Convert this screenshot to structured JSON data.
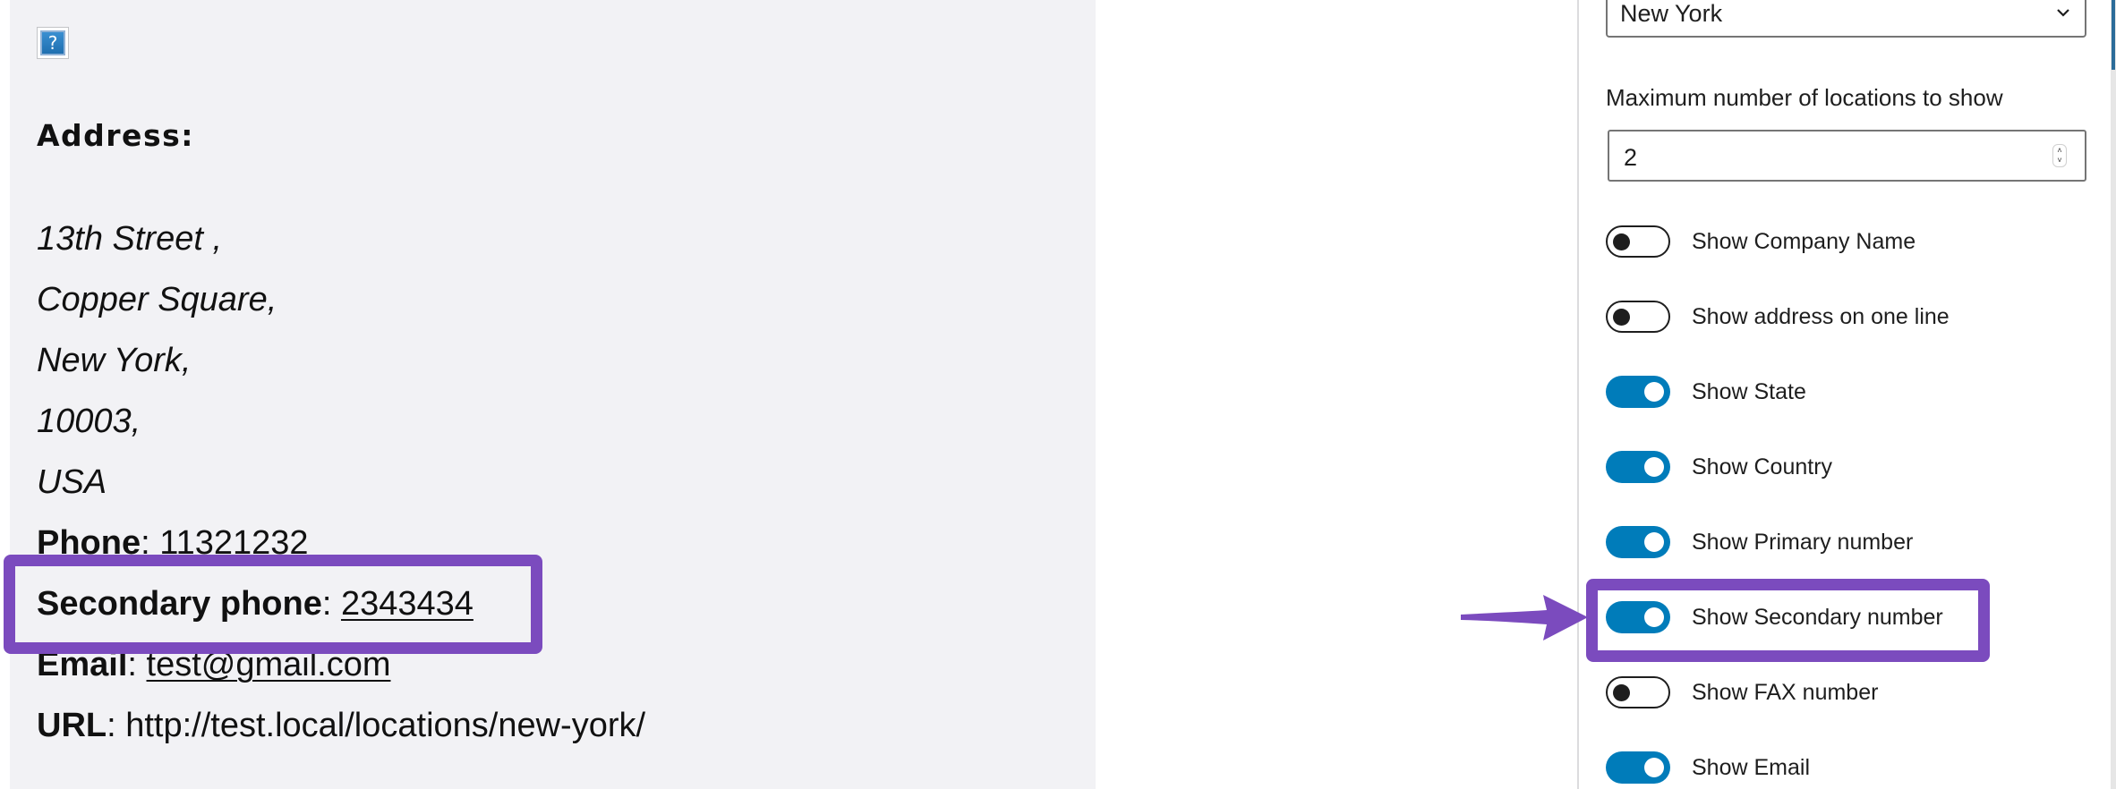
{
  "preview": {
    "help_icon_glyph": "?",
    "address_heading": "Address:",
    "address_lines": [
      "13th Street ,",
      "Copper Square,",
      "New York,",
      "10003,",
      "USA"
    ],
    "phone": {
      "label": "Phone",
      "sep": ": ",
      "value": "11321232"
    },
    "secondary_phone": {
      "label": "Secondary phone",
      "sep": ": ",
      "value": "2343434"
    },
    "email": {
      "label": "Email",
      "sep": ": ",
      "value": "test@gmail.com"
    },
    "url": {
      "label": "URL",
      "sep": ": ",
      "value": "http://test.local/locations/new-york/"
    }
  },
  "sidebar": {
    "location_select": {
      "selected": "New York"
    },
    "max_locations": {
      "label": "Maximum number of locations to show",
      "value": "2"
    },
    "toggles": [
      {
        "label": "Show Company Name",
        "on": false
      },
      {
        "label": "Show address on one line",
        "on": false
      },
      {
        "label": "Show State",
        "on": true
      },
      {
        "label": "Show Country",
        "on": true
      },
      {
        "label": "Show Primary number",
        "on": true
      },
      {
        "label": "Show Secondary number",
        "on": true
      },
      {
        "label": "Show FAX number",
        "on": false
      },
      {
        "label": "Show Email",
        "on": true
      }
    ]
  },
  "annotation": {
    "highlight_color": "#7b4bbe",
    "toggle_on_color": "#007cba"
  }
}
